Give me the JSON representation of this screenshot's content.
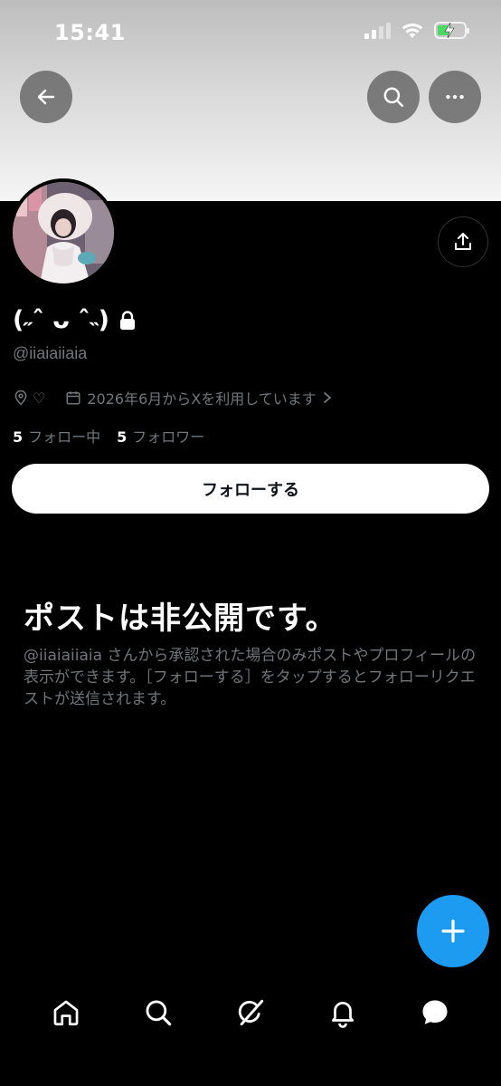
{
  "status_bar": {
    "time": "15:41"
  },
  "profile": {
    "display_name": "(˶ˆ ᴗ ˆ˵)",
    "handle": "@iiaiaiiaia",
    "location": "♡",
    "joined": "2026年6月からXを利用しています",
    "following_count": "5",
    "following_label": "フォロー中",
    "followers_count": "5",
    "followers_label": "フォロワー",
    "follow_button_label": "フォローする"
  },
  "private_notice": {
    "title": "ポストは非公開です。",
    "description": "@iiaiaiiaia さんから承認された場合のみポストやプロフィールの表示ができます。［フォローする］をタップするとフォローリクエストが送信されます。"
  },
  "icons": {
    "back": "back-arrow-icon",
    "search": "search-icon",
    "more": "more-icon",
    "share": "share-icon",
    "lock": "lock-icon",
    "location": "location-pin-icon",
    "calendar": "calendar-icon",
    "compose": "plus-icon",
    "tabs": [
      "home-icon",
      "search-icon",
      "grok-icon",
      "bell-icon",
      "messages-icon"
    ]
  },
  "colors": {
    "accent": "#1d9bf0",
    "background": "#000000",
    "secondary_text": "#71767b",
    "battery_charging": "#4cd964"
  }
}
